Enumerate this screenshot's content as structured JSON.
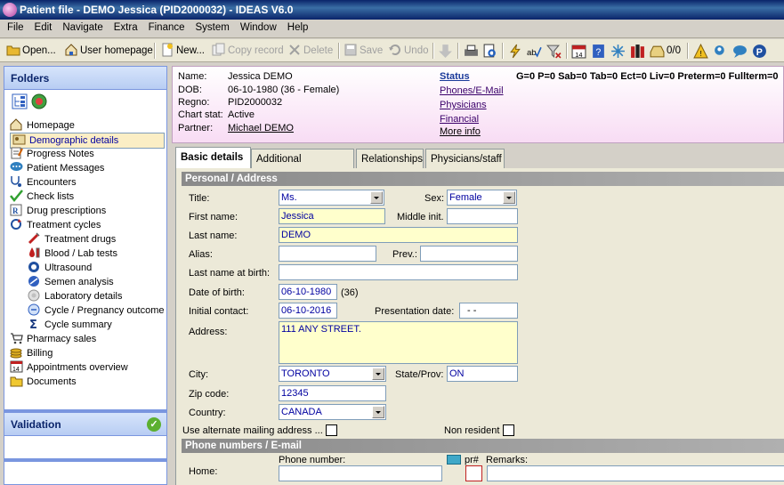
{
  "window": {
    "title": "Patient file - DEMO Jessica (PID2000032) - IDEAS V6.0"
  },
  "menu": [
    "File",
    "Edit",
    "Navigate",
    "Extra",
    "Finance",
    "System",
    "Window",
    "Help"
  ],
  "toolbar": {
    "open": "Open...",
    "user_homepage": "User homepage",
    "new": "New...",
    "copy_record": "Copy record",
    "delete": "Delete",
    "save": "Save",
    "undo": "Undo",
    "counter": "0/0"
  },
  "folders": {
    "title": "Folders",
    "items": [
      {
        "label": "Homepage",
        "icon": "home-icon"
      },
      {
        "label": "Demographic details",
        "icon": "id-card-icon",
        "selected": true
      },
      {
        "label": "Progress Notes",
        "icon": "notes-icon"
      },
      {
        "label": "Patient Messages",
        "icon": "messages-icon"
      },
      {
        "label": "Encounters",
        "icon": "stethoscope-icon"
      },
      {
        "label": "Check lists",
        "icon": "checkmark-icon"
      },
      {
        "label": "Drug prescriptions",
        "icon": "prescription-icon"
      },
      {
        "label": "Treatment cycles",
        "icon": "cycle-icon"
      },
      {
        "label": "Treatment drugs",
        "icon": "syringe-icon"
      },
      {
        "label": "Blood / Lab tests",
        "icon": "blood-drop-icon"
      },
      {
        "label": "Ultrasound",
        "icon": "ultrasound-icon"
      },
      {
        "label": "Semen analysis",
        "icon": "semen-icon"
      },
      {
        "label": "Laboratory details",
        "icon": "lab-icon"
      },
      {
        "label": "Cycle / Pregnancy outcome",
        "icon": "outcome-icon"
      },
      {
        "label": "Cycle summary",
        "icon": "sigma-icon"
      },
      {
        "label": "Pharmacy sales",
        "icon": "cart-icon"
      },
      {
        "label": "Billing",
        "icon": "coins-icon"
      },
      {
        "label": "Appointments overview",
        "icon": "calendar-icon"
      },
      {
        "label": "Documents",
        "icon": "folder-icon"
      }
    ]
  },
  "validation": {
    "title": "Validation"
  },
  "patient": {
    "name_label": "Name:",
    "name": "Jessica DEMO",
    "dob_label": "DOB:",
    "dob": "06-10-1980 (36 - Female)",
    "regno_label": "Regno:",
    "regno": "PID2000032",
    "chart_label": "Chart stat:",
    "chart": "Active",
    "partner_label": "Partner:",
    "partner": "Michael DEMO",
    "status_link": "Status",
    "phones_link": "Phones/E-Mail",
    "physicians_link": "Physicians",
    "financial_link": "Financial",
    "more_link": "More info",
    "counts": "G=0 P=0 Sab=0 Tab=0 Ect=0 Liv=0 Preterm=0 Fullterm=0"
  },
  "tabs": [
    "Basic details",
    "Additional information",
    "Relationships",
    "Physicians/staff"
  ],
  "form": {
    "section_personal": "Personal / Address",
    "title_label": "Title:",
    "title_value": "Ms.",
    "sex_label": "Sex:",
    "sex_value": "Female",
    "first_name_label": "First name:",
    "first_name": "Jessica",
    "middle_label": "Middle init.",
    "middle": "",
    "last_name_label": "Last name:",
    "last_name": "DEMO",
    "alias_label": "Alias:",
    "alias": "",
    "prev_label": "Prev.:",
    "prev": "",
    "birth_name_label": "Last name at birth:",
    "birth_name": "",
    "dob_label": "Date of birth:",
    "dob": "06-10-1980",
    "age": "(36)",
    "initial_label": "Initial contact:",
    "initial": "06-10-2016",
    "presentation_label": "Presentation date:",
    "presentation": "- -",
    "address_label": "Address:",
    "address": "111 ANY STREET.",
    "city_label": "City:",
    "city": "TORONTO",
    "state_label": "State/Prov:",
    "state": "ON",
    "zip_label": "Zip code:",
    "zip": "12345",
    "country_label": "Country:",
    "country": "CANADA",
    "alt_mail_label": "Use alternate mailing address ...",
    "non_resident_label": "Non resident",
    "section_phone": "Phone numbers / E-mail",
    "phone_number_label": "Phone number:",
    "pr_label": "pr#",
    "remarks_label": "Remarks:",
    "home_label": "Home:"
  }
}
